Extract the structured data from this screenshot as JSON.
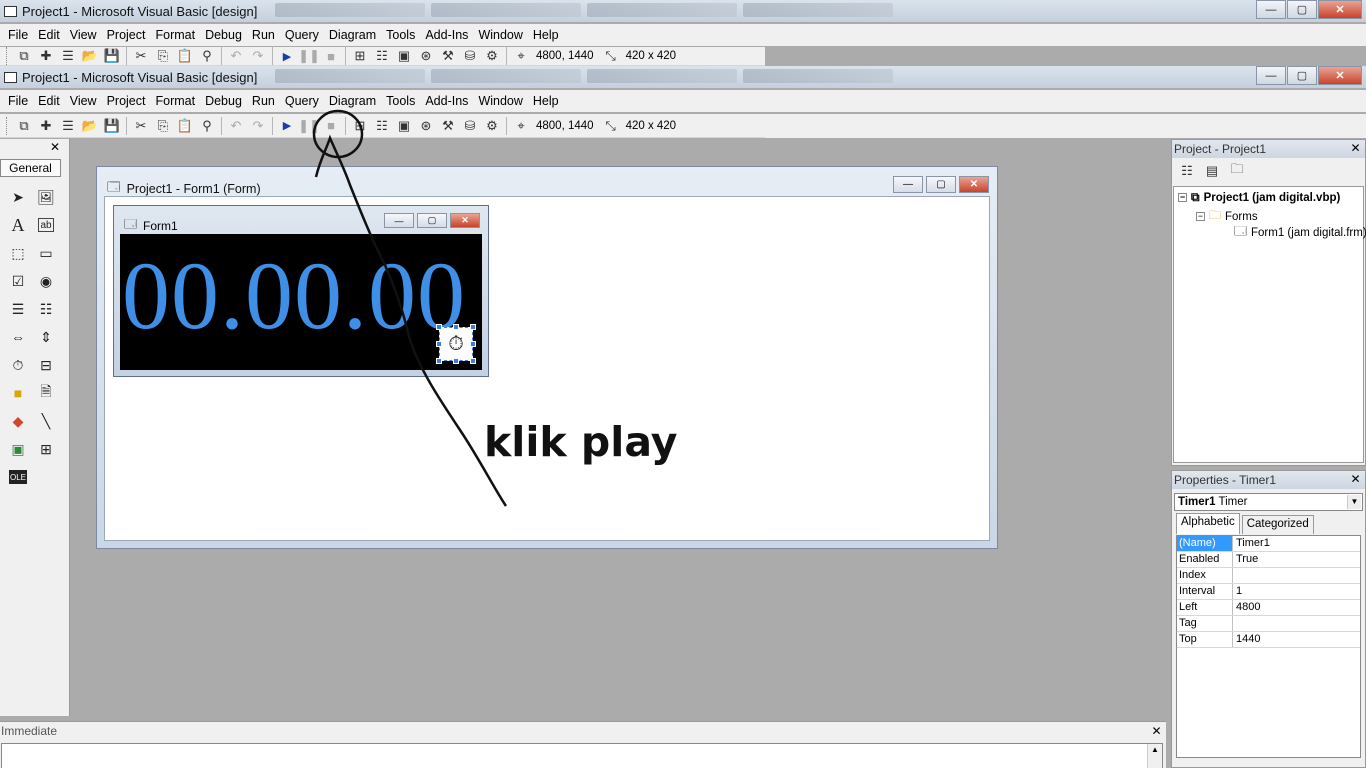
{
  "bg_window": {
    "title": "Project1 - Microsoft Visual Basic [design]",
    "menu": [
      "File",
      "Edit",
      "View",
      "Project",
      "Format",
      "Debug",
      "Run",
      "Query",
      "Diagram",
      "Tools",
      "Add-Ins",
      "Window",
      "Help"
    ],
    "position": "4800, 1440",
    "size": "420 x 420"
  },
  "window": {
    "title": "Project1 - Microsoft Visual Basic [design]",
    "controls": {
      "minimize": "—",
      "maximize": "▢",
      "close": "✕"
    }
  },
  "menu": {
    "items": [
      "File",
      "Edit",
      "View",
      "Project",
      "Format",
      "Debug",
      "Run",
      "Query",
      "Diagram",
      "Tools",
      "Add-Ins",
      "Window",
      "Help"
    ]
  },
  "toolbar": {
    "position_readout": "4800, 1440",
    "size_readout": "420 x 420"
  },
  "toolbox": {
    "tab_label": "General",
    "close": "✕",
    "tools": [
      "pointer-icon",
      "picturebox-icon",
      "label-icon",
      "textbox-icon",
      "frame-icon",
      "commandbutton-icon",
      "checkbox-icon",
      "optionbutton-icon",
      "combobox-icon",
      "listbox-icon",
      "hscrollbar-icon",
      "vscrollbar-icon",
      "timer-icon",
      "drivelistbox-icon",
      "dirlistbox-icon",
      "filelistbox-icon",
      "shape-icon",
      "line-icon",
      "image-icon",
      "data-icon",
      "ole-icon"
    ]
  },
  "form_designer": {
    "title": "Project1 - Form1 (Form)",
    "form": {
      "title": "Form1",
      "clock_text": "00.00.00",
      "clock_color": "#3f8fe6"
    }
  },
  "annotation": {
    "text": "klik play"
  },
  "project_explorer": {
    "title": "Project - Project1",
    "close": "✕",
    "tree": {
      "project": "Project1 (jam digital.vbp)",
      "folder": "Forms",
      "form": "Form1 (jam digital.frm)"
    }
  },
  "properties": {
    "title": "Properties - Timer1",
    "close": "✕",
    "object_name": "Timer1",
    "object_type": "Timer",
    "tabs": [
      "Alphabetic",
      "Categorized"
    ],
    "rows": [
      {
        "name": "(Name)",
        "value": "Timer1"
      },
      {
        "name": "Enabled",
        "value": "True"
      },
      {
        "name": "Index",
        "value": ""
      },
      {
        "name": "Interval",
        "value": "1"
      },
      {
        "name": "Left",
        "value": "4800"
      },
      {
        "name": "Tag",
        "value": ""
      },
      {
        "name": "Top",
        "value": "1440"
      }
    ]
  },
  "immediate": {
    "title": "Immediate",
    "close": "✕"
  },
  "colors": {
    "accent_selection": "#3399ff",
    "close_button": "#c8432b",
    "mdi_background": "#ababab"
  }
}
